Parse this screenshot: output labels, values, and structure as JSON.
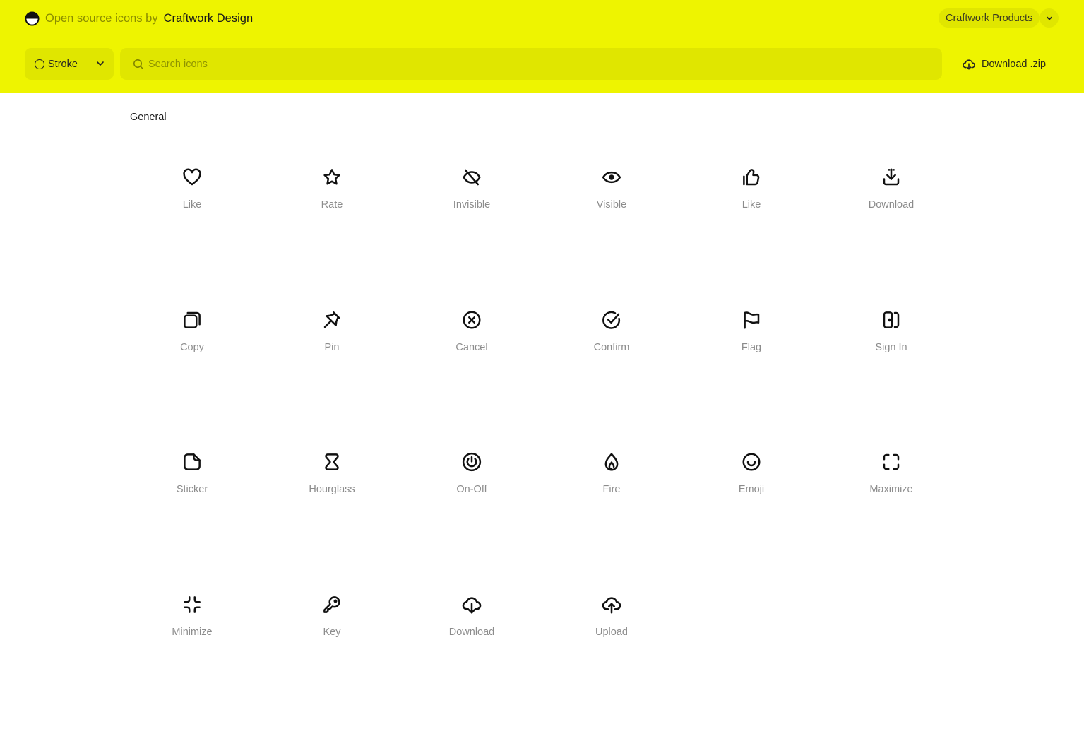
{
  "header": {
    "brand_prefix": "Open source icons by",
    "brand_name": "Craftwork Design",
    "products_label": "Craftwork Products",
    "style_select": {
      "value": "Stroke"
    },
    "search": {
      "placeholder": "Search icons",
      "value": ""
    },
    "download_zip_label": "Download .zip"
  },
  "colors": {
    "accent": "#eef400",
    "control_bg": "#e0e600",
    "label_gray": "#8c8c8c"
  },
  "section": {
    "title": "General",
    "icons": [
      {
        "label": "Like",
        "icon": "heart-icon"
      },
      {
        "label": "Rate",
        "icon": "star-icon"
      },
      {
        "label": "Invisible",
        "icon": "eye-off-icon"
      },
      {
        "label": "Visible",
        "icon": "eye-icon"
      },
      {
        "label": "Like",
        "icon": "thumbs-up-icon"
      },
      {
        "label": "Download",
        "icon": "download-tray-icon"
      },
      {
        "label": "Copy",
        "icon": "copy-icon"
      },
      {
        "label": "Pin",
        "icon": "pin-icon"
      },
      {
        "label": "Cancel",
        "icon": "cancel-circle-icon"
      },
      {
        "label": "Confirm",
        "icon": "confirm-circle-icon"
      },
      {
        "label": "Flag",
        "icon": "flag-icon"
      },
      {
        "label": "Sign In",
        "icon": "sign-in-icon"
      },
      {
        "label": "Sticker",
        "icon": "sticker-icon"
      },
      {
        "label": "Hourglass",
        "icon": "hourglass-icon"
      },
      {
        "label": "On-Off",
        "icon": "power-icon"
      },
      {
        "label": "Fire",
        "icon": "fire-icon"
      },
      {
        "label": "Emoji",
        "icon": "emoji-icon"
      },
      {
        "label": "Maximize",
        "icon": "maximize-icon"
      },
      {
        "label": "Minimize",
        "icon": "minimize-icon"
      },
      {
        "label": "Key",
        "icon": "key-icon"
      },
      {
        "label": "Download",
        "icon": "cloud-download-icon"
      },
      {
        "label": "Upload",
        "icon": "cloud-upload-icon"
      }
    ]
  }
}
